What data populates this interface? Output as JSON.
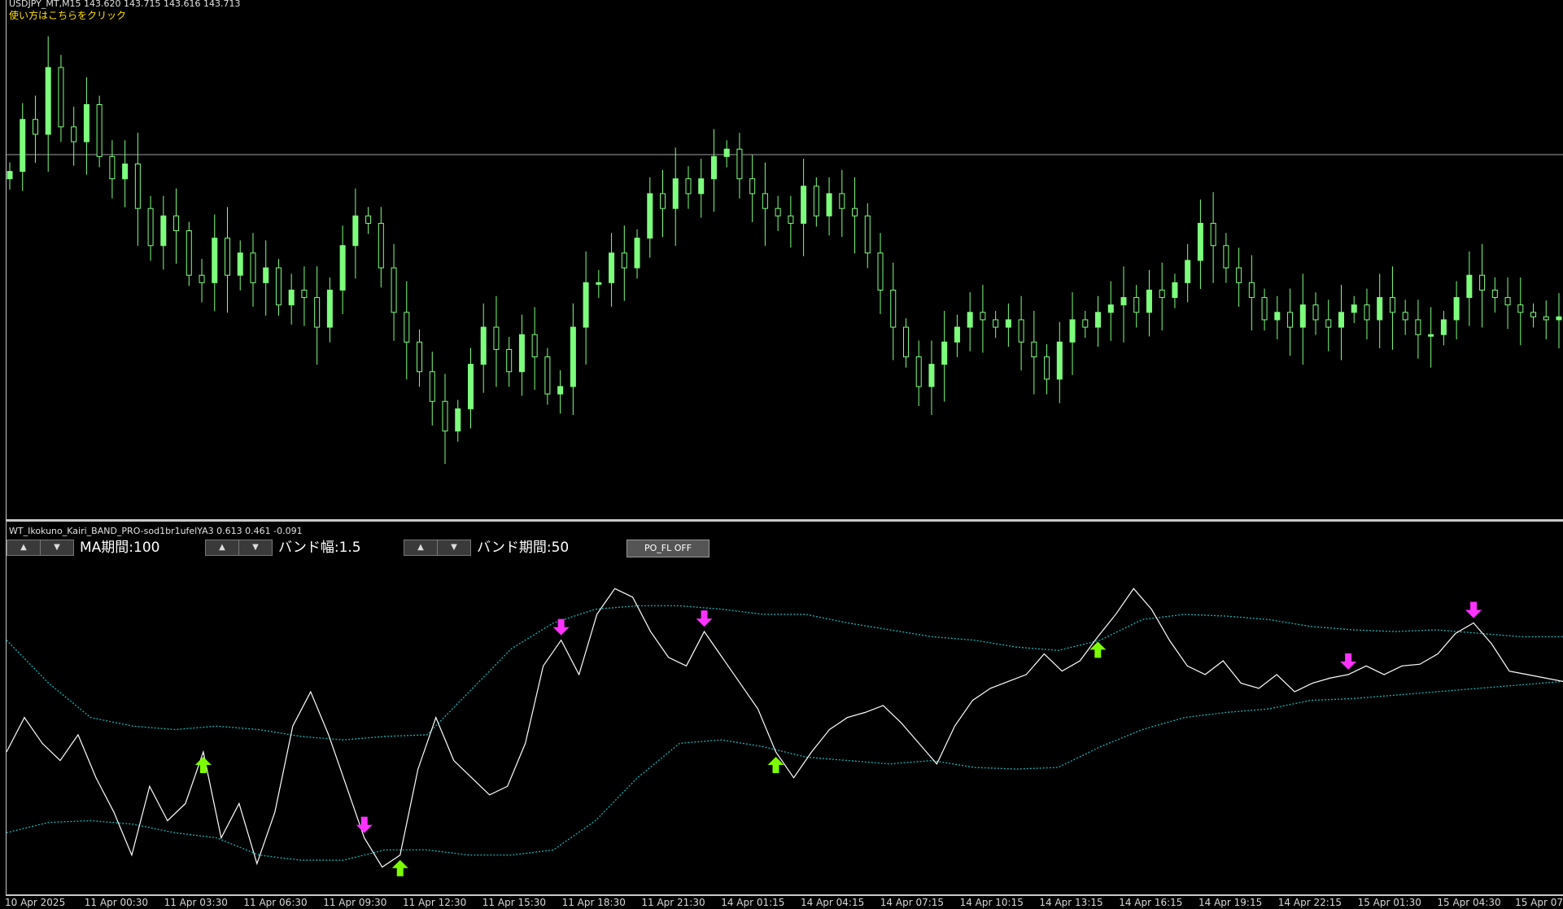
{
  "header": {
    "symbol_info": "USDJPY_MT,M15  143.620 143.715 143.616 143.713",
    "help_link": "使い方はこちらをクリック"
  },
  "indicator": {
    "title": "WT_Ikokuno_Kairi_BAND_PRO-sod1br1ufelYA3 0.613 0.461 -0.091",
    "params": [
      {
        "label": "MA期間:100",
        "up": "▲",
        "down": "▼"
      },
      {
        "label": "バンド幅:1.5",
        "up": "▲",
        "down": "▼"
      },
      {
        "label": "バンド期間:50",
        "up": "▲",
        "down": "▼"
      }
    ],
    "po_button": "PO_FL OFF"
  },
  "x_axis": {
    "labels": [
      "10 Apr 2025",
      "11 Apr 00:30",
      "11 Apr 03:30",
      "11 Apr 06:30",
      "11 Apr 09:30",
      "11 Apr 12:30",
      "11 Apr 15:30",
      "11 Apr 18:30",
      "11 Apr 21:30",
      "14 Apr 01:15",
      "14 Apr 04:15",
      "14 Apr 07:15",
      "14 Apr 10:15",
      "14 Apr 13:15",
      "14 Apr 16:15",
      "14 Apr 19:15",
      "14 Apr 22:15",
      "15 Apr 01:30",
      "15 Apr 04:30",
      "15 Apr 07"
    ]
  },
  "colors": {
    "background": "#000000",
    "candle": "#7dff7d",
    "oscillator": "#ffffff",
    "band": "#19b4b4",
    "price_line": "#a0a0a0",
    "buy_arrow": "#7cfc00",
    "sell_arrow": "#ff33ff"
  },
  "chart_data": {
    "type": "candlestick",
    "price_chart": {
      "closes": [
        143.6,
        143.95,
        143.85,
        144.3,
        143.9,
        143.8,
        144.05,
        143.7,
        143.55,
        143.65,
        143.35,
        143.1,
        143.3,
        143.2,
        142.9,
        142.85,
        143.15,
        142.9,
        143.05,
        142.85,
        142.95,
        142.7,
        142.8,
        142.75,
        142.55,
        142.8,
        143.1,
        143.3,
        143.25,
        142.95,
        142.65,
        142.45,
        142.25,
        142.05,
        141.85,
        142.0,
        142.3,
        142.55,
        142.4,
        142.25,
        142.5,
        142.35,
        142.1,
        142.15,
        142.55,
        142.85,
        142.85,
        143.05,
        142.95,
        143.15,
        143.45,
        143.35,
        143.55,
        143.45,
        143.55,
        143.7,
        143.75,
        143.55,
        143.45,
        143.35,
        143.3,
        143.25,
        143.5,
        143.3,
        143.45,
        143.35,
        143.3,
        143.05,
        142.8,
        142.55,
        142.35,
        142.15,
        142.3,
        142.45,
        142.55,
        142.65,
        142.6,
        142.55,
        142.6,
        142.45,
        142.35,
        142.2,
        142.45,
        142.6,
        142.55,
        142.65,
        142.7,
        142.75,
        142.65,
        142.8,
        142.75,
        142.85,
        143.0,
        143.25,
        143.1,
        142.95,
        142.85,
        142.75,
        142.6,
        142.65,
        142.55,
        142.7,
        142.6,
        142.55,
        142.65,
        142.7,
        142.6,
        142.75,
        142.65,
        142.6,
        142.5,
        142.5,
        142.6,
        142.75,
        142.9,
        142.8,
        142.75,
        142.7,
        142.65,
        142.62,
        142.6,
        142.62
      ],
      "last_price": 143.713
    },
    "oscillator": {
      "main": [
        0.05,
        0.25,
        0.1,
        0.0,
        0.15,
        -0.1,
        -0.3,
        -0.55,
        -0.15,
        -0.35,
        -0.25,
        0.05,
        -0.45,
        -0.25,
        -0.6,
        -0.3,
        0.2,
        0.4,
        0.15,
        -0.15,
        -0.45,
        -0.62,
        -0.55,
        -0.05,
        0.25,
        0.0,
        -0.1,
        -0.2,
        -0.15,
        0.1,
        0.55,
        0.7,
        0.5,
        0.85,
        1.0,
        0.95,
        0.75,
        0.6,
        0.55,
        0.75,
        0.6,
        0.45,
        0.3,
        0.05,
        -0.1,
        0.05,
        0.18,
        0.25,
        0.28,
        0.32,
        0.22,
        0.1,
        -0.02,
        0.2,
        0.35,
        0.42,
        0.46,
        0.5,
        0.62,
        0.52,
        0.58,
        0.72,
        0.85,
        1.0,
        0.88,
        0.7,
        0.55,
        0.5,
        0.58,
        0.45,
        0.42,
        0.5,
        0.4,
        0.45,
        0.48,
        0.5,
        0.55,
        0.5,
        0.55,
        0.56,
        0.62,
        0.74,
        0.8,
        0.68,
        0.52,
        0.5,
        0.48,
        0.46
      ],
      "upper_band": [
        0.7,
        0.45,
        0.25,
        0.2,
        0.18,
        0.2,
        0.18,
        0.14,
        0.12,
        0.14,
        0.15,
        0.4,
        0.65,
        0.8,
        0.88,
        0.9,
        0.9,
        0.88,
        0.85,
        0.85,
        0.8,
        0.76,
        0.72,
        0.7,
        0.66,
        0.64,
        0.7,
        0.82,
        0.85,
        0.84,
        0.82,
        0.78,
        0.76,
        0.75,
        0.76,
        0.74,
        0.72,
        0.72
      ],
      "lower_band": [
        -0.42,
        -0.36,
        -0.35,
        -0.37,
        -0.42,
        -0.45,
        -0.55,
        -0.58,
        -0.58,
        -0.52,
        -0.52,
        -0.55,
        -0.55,
        -0.52,
        -0.35,
        -0.1,
        0.1,
        0.12,
        0.08,
        0.02,
        0.0,
        -0.02,
        0.0,
        -0.04,
        -0.05,
        -0.04,
        0.08,
        0.18,
        0.25,
        0.28,
        0.3,
        0.35,
        0.36,
        0.38,
        0.4,
        0.42,
        0.44,
        0.46
      ],
      "buy_signals": [
        11,
        22,
        43,
        61
      ],
      "sell_signals": [
        20,
        31,
        39,
        75,
        82
      ]
    }
  }
}
